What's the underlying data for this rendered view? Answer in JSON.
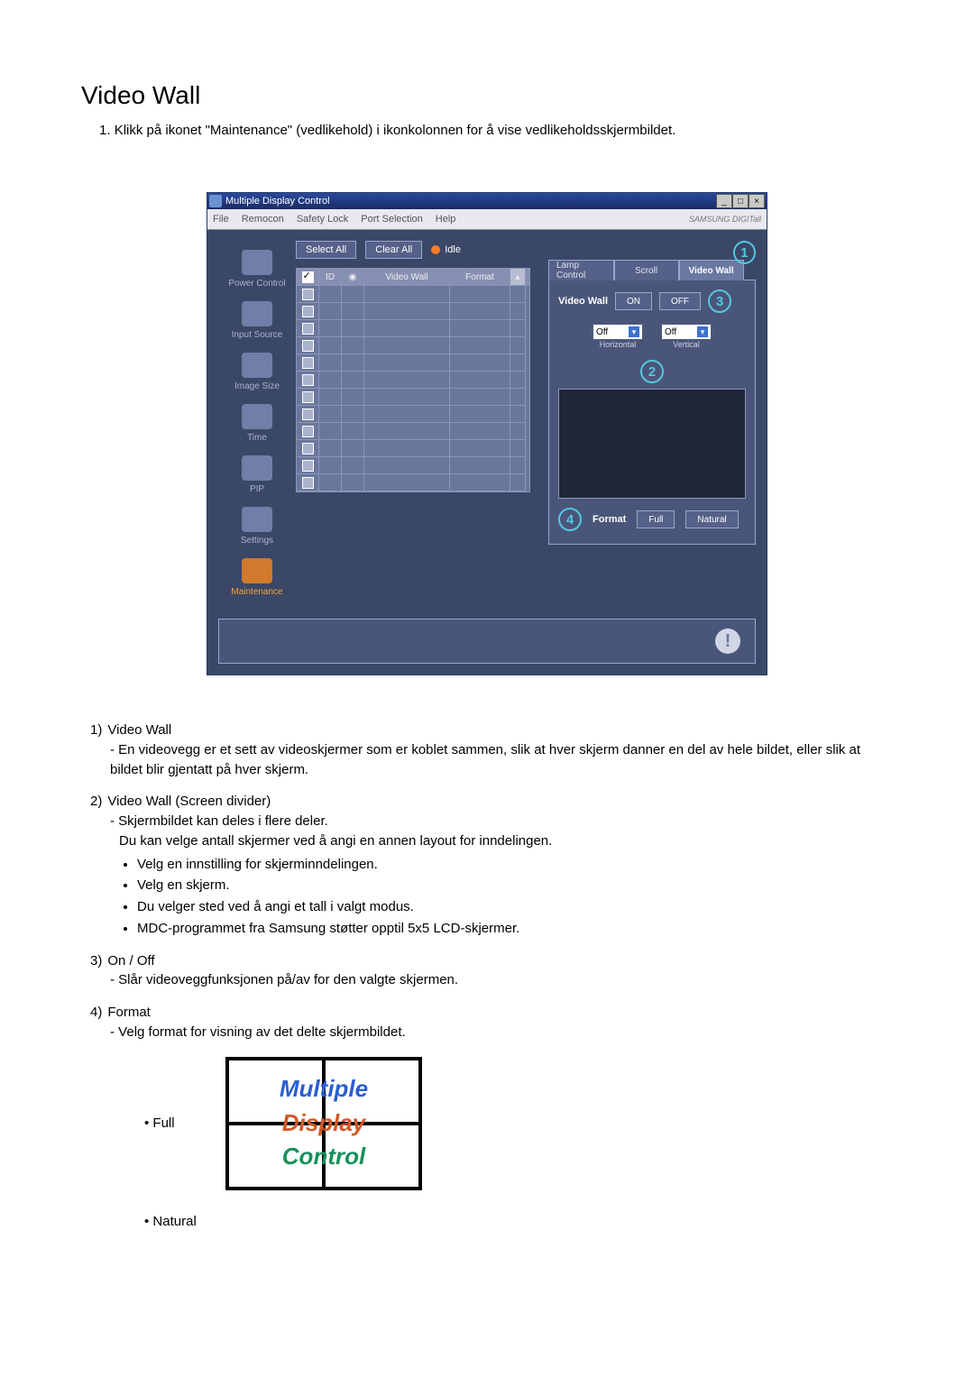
{
  "title": "Video Wall",
  "intro_num": "1.",
  "intro": "Klikk på ikonet \"Maintenance\" (vedlikehold) i ikonkolonnen for å vise vedlikeholdsskjermbildet.",
  "screenshot": {
    "window_title": "Multiple Display Control",
    "menubar": [
      "File",
      "Remocon",
      "Safety Lock",
      "Port Selection",
      "Help"
    ],
    "brand": "SAMSUNG DIGITall",
    "sidebar": [
      {
        "label": "Power Control"
      },
      {
        "label": "Input Source"
      },
      {
        "label": "Image Size"
      },
      {
        "label": "Time"
      },
      {
        "label": "PIP"
      },
      {
        "label": "Settings"
      },
      {
        "label": "Maintenance",
        "active": true
      }
    ],
    "select_all": "Select All",
    "clear_all": "Clear All",
    "idle": "Idle",
    "grid_head": {
      "id": "ID",
      "vw": "Video Wall",
      "fmt": "Format"
    },
    "tabs": {
      "lamp": "Lamp Control",
      "scroll": "Scroll",
      "videowall": "Video Wall"
    },
    "vw_label": "Video Wall",
    "on": "ON",
    "off": "OFF",
    "ddl_off": "Off",
    "horizontal": "Horizontal",
    "vertical": "Vertical",
    "format_label": "Format",
    "full": "Full",
    "natural": "Natural",
    "callouts": {
      "c1": "1",
      "c2": "2",
      "c3": "3",
      "c4": "4"
    }
  },
  "list": {
    "i1_num": "1)",
    "i1_title": "Video Wall",
    "i1_dash": "En videovegg er et sett av videoskjermer som er koblet sammen, slik at hver skjerm danner en del av hele bildet, eller slik at bildet blir gjentatt på hver skjerm.",
    "i2_num": "2)",
    "i2_title": "Video Wall (Screen divider)",
    "i2_dash": "Skjermbildet kan deles i flere deler.",
    "i2_line2": "Du kan velge antall skjermer ved å angi en annen layout for inndelingen.",
    "i2_bul": [
      "Velg en innstilling for skjerminndelingen.",
      "Velg en skjerm.",
      "Du velger sted ved å angi et tall i valgt modus.",
      "MDC-programmet fra Samsung støtter opptil 5x5 LCD-skjermer."
    ],
    "i3_num": "3)",
    "i3_title": "On / Off",
    "i3_dash": "Slår videoveggfunksjonen på/av for den valgte skjermen.",
    "i4_num": "4)",
    "i4_title": "Format",
    "i4_dash": "Velg format for visning av det delte skjermbildet.",
    "full": "Full",
    "natural": "Natural",
    "mdc1": "Multiple",
    "mdc2": "Display",
    "mdc3": "Control"
  }
}
